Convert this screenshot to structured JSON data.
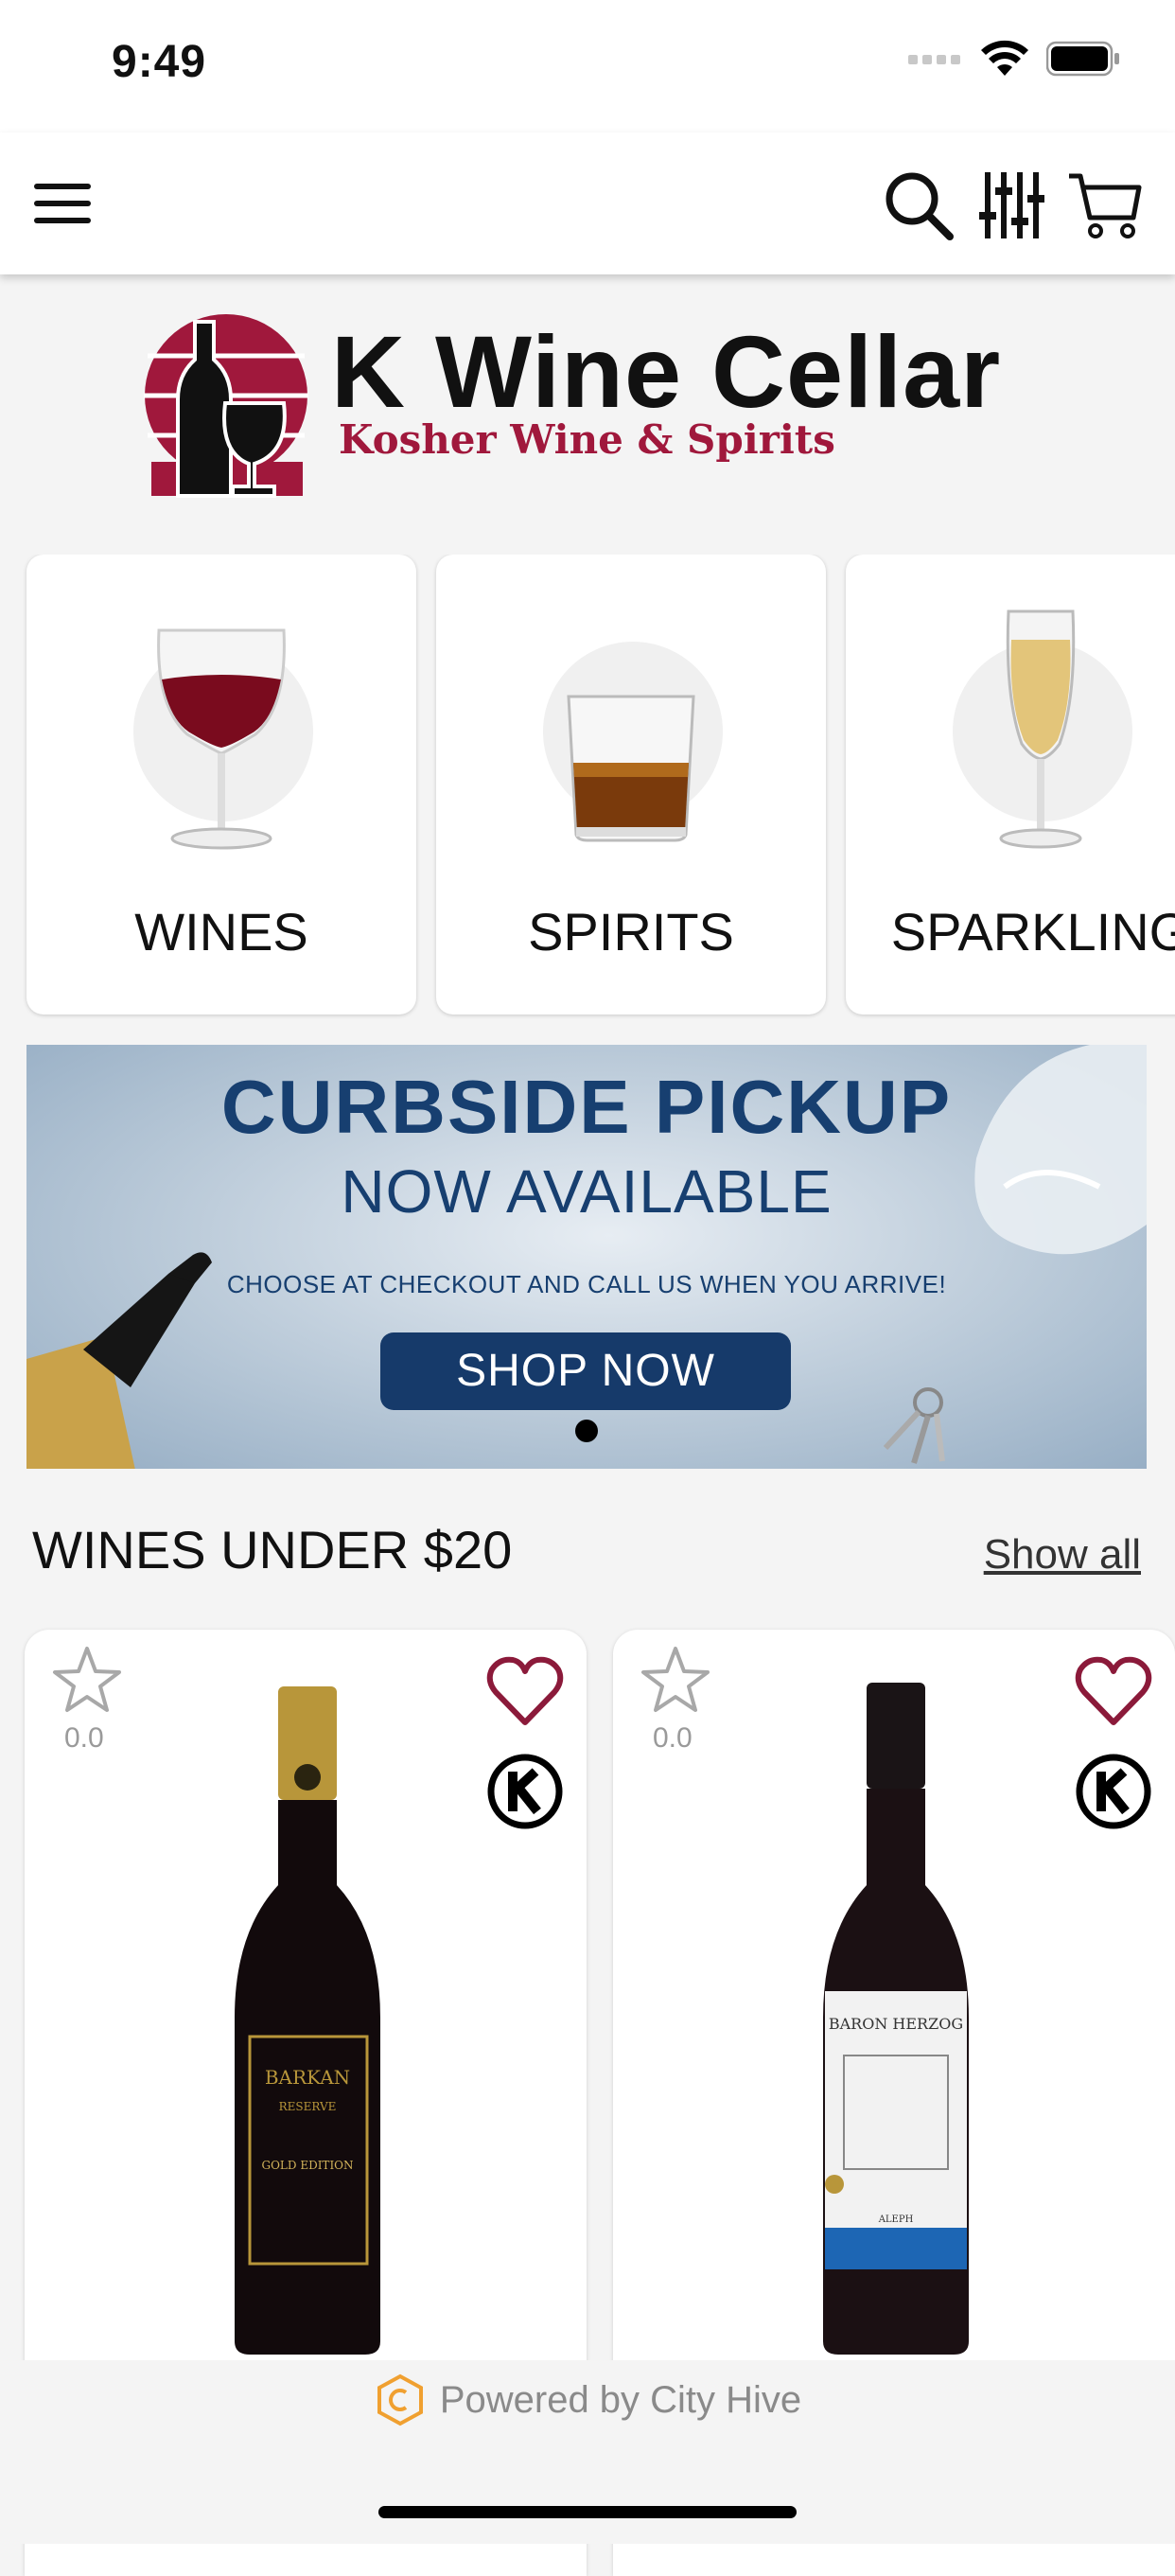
{
  "status": {
    "time": "9:49"
  },
  "header": {
    "menu_icon": "hamburger-icon",
    "search_icon": "search-icon",
    "filter_icon": "filter-icon",
    "cart_icon": "cart-icon"
  },
  "logo": {
    "title": "K Wine Cellar",
    "subtitle": "Kosher Wine & Spirits"
  },
  "categories": [
    {
      "label": "WINES",
      "icon": "wine-glass"
    },
    {
      "label": "SPIRITS",
      "icon": "whiskey-glass"
    },
    {
      "label": "SPARKLING",
      "icon": "champagne-flute"
    }
  ],
  "banner": {
    "line1": "CURBSIDE PICKUP",
    "line2": "NOW AVAILABLE",
    "line3": "CHOOSE AT CHECKOUT AND CALL US WHEN YOU ARRIVE!",
    "button": "SHOP NOW"
  },
  "section": {
    "title": "WINES UNDER $20",
    "show_all": "Show all"
  },
  "products": [
    {
      "rating": "0.0",
      "bottle_label": "BARKAN",
      "bottle_sub": "RESERVE",
      "bottle_edition": "GOLD EDITION"
    },
    {
      "rating": "0.0",
      "bottle_label": "BARON HERZOG",
      "bottle_sub": "ALEPH"
    }
  ],
  "footer": {
    "powered_by": "Powered by City Hive"
  },
  "colors": {
    "brand": "#a0183c",
    "navy": "#173f70",
    "heart": "#8b1a3a"
  }
}
